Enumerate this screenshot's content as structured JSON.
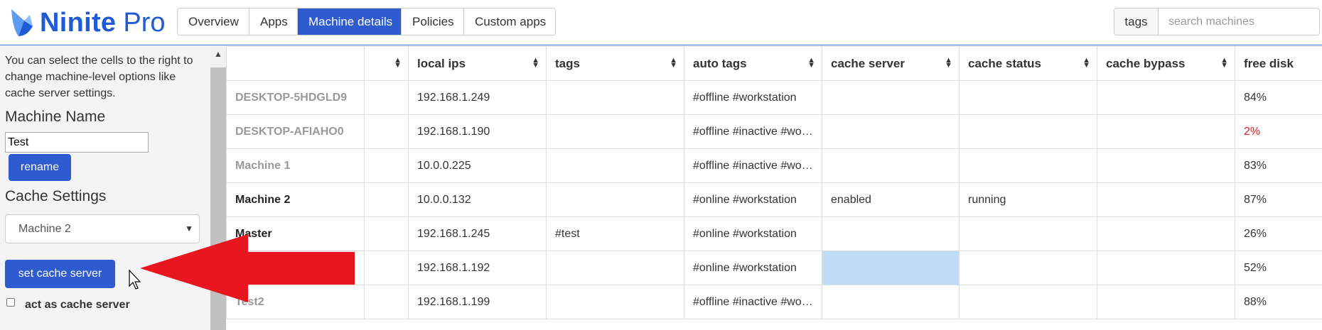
{
  "app": {
    "logo_name": "Ninite",
    "logo_pro": "Pro",
    "brand_color": "#1f5bd6"
  },
  "nav": {
    "tabs": [
      {
        "label": "Overview",
        "active": false
      },
      {
        "label": "Apps",
        "active": false
      },
      {
        "label": "Machine details",
        "active": true
      },
      {
        "label": "Policies",
        "active": false
      },
      {
        "label": "Custom apps",
        "active": false
      }
    ]
  },
  "search": {
    "tag_label": "tags",
    "placeholder": "search machines"
  },
  "sidebar": {
    "help_text": "You can select the cells to the right to change machine-level options like cache server settings.",
    "machine_name_title": "Machine Name",
    "machine_name_value": "Test",
    "rename_label": "rename",
    "cache_settings_title": "Cache Settings",
    "cache_select_value": "Machine 2",
    "set_cache_label": "set cache server",
    "act_as_cache_label": "act as cache server"
  },
  "table": {
    "headers": [
      "",
      "",
      "local ips",
      "tags",
      "auto tags",
      "cache server",
      "cache status",
      "cache bypass",
      "free disk"
    ],
    "rows": [
      {
        "name": "DESKTOP-5HDGLD9",
        "online": false,
        "ip": "192.168.1.249",
        "tags": "",
        "auto_tags": "#offline #workstation",
        "cache_server": "",
        "cache_status": "",
        "cache_bypass": "",
        "free_disk": "84%"
      },
      {
        "name": "DESKTOP-AFIAHO0",
        "online": false,
        "ip": "192.168.1.190",
        "tags": "",
        "auto_tags": "#offline #inactive #workstation",
        "cache_server": "",
        "cache_status": "",
        "cache_bypass": "",
        "free_disk": "2%"
      },
      {
        "name": "Machine 1",
        "online": false,
        "ip": "10.0.0.225",
        "tags": "",
        "auto_tags": "#offline #inactive #workstation",
        "cache_server": "",
        "cache_status": "",
        "cache_bypass": "",
        "free_disk": "83%"
      },
      {
        "name": "Machine 2",
        "online": true,
        "ip": "10.0.0.132",
        "tags": "",
        "auto_tags": "#online #workstation",
        "cache_server": "enabled",
        "cache_status": "running",
        "cache_bypass": "",
        "free_disk": "87%"
      },
      {
        "name": "Master",
        "online": true,
        "ip": "192.168.1.245",
        "tags": "#test",
        "auto_tags": "#online #workstation",
        "cache_server": "",
        "cache_status": "",
        "cache_bypass": "",
        "free_disk": "26%"
      },
      {
        "name": "",
        "online": true,
        "ip": "192.168.1.192",
        "tags": "",
        "auto_tags": "#online #workstation",
        "cache_server": "",
        "cache_status": "",
        "cache_bypass": "",
        "free_disk": "52%"
      },
      {
        "name": "Test2",
        "online": false,
        "ip": "192.168.1.199",
        "tags": "",
        "auto_tags": "#offline #inactive #workstation",
        "cache_server": "",
        "cache_status": "",
        "cache_bypass": "",
        "free_disk": "88%"
      }
    ]
  },
  "colors": {
    "primary_button": "#2f5bd0",
    "selected_cell": "#bfdcf7",
    "low_disk": "#e02020",
    "arrow": "#e8161f"
  }
}
